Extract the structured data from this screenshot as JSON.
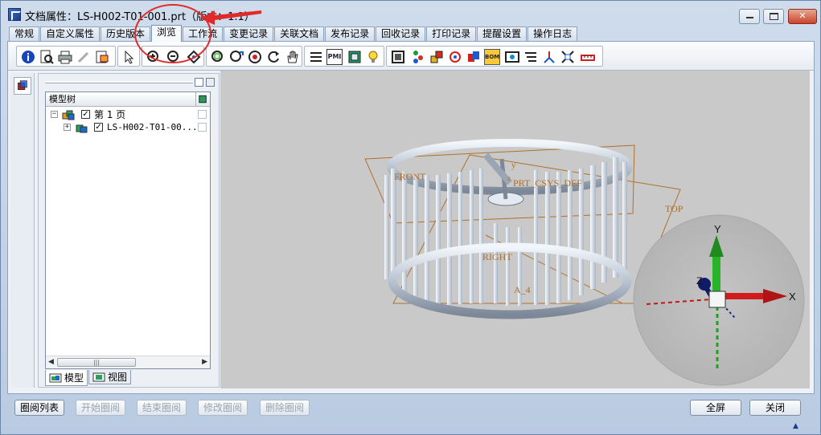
{
  "window": {
    "title": "文档属性：LS-H002-T01-001.prt（版本：1.1）",
    "minimize_glyph": "—",
    "restore_glyph": "",
    "close_glyph": "✕"
  },
  "tabs": [
    {
      "label": "常规",
      "active": false
    },
    {
      "label": "自定义属性",
      "active": false
    },
    {
      "label": "历史版本",
      "active": false
    },
    {
      "label": "浏览",
      "active": true
    },
    {
      "label": "工作流",
      "active": false
    },
    {
      "label": "变更记录",
      "active": false
    },
    {
      "label": "关联文档",
      "active": false
    },
    {
      "label": "发布记录",
      "active": false
    },
    {
      "label": "回收记录",
      "active": false
    },
    {
      "label": "打印记录",
      "active": false
    },
    {
      "label": "提醒设置",
      "active": false
    },
    {
      "label": "操作日志",
      "active": false
    }
  ],
  "toolbar": {
    "group1": [
      "info-icon",
      "print-preview-icon",
      "print-icon",
      "pen-icon",
      "export-icon"
    ],
    "group2": [
      "pointer-icon"
    ],
    "group3": [
      "zoom-in-icon",
      "zoom-out-icon",
      "zoom-fit-icon"
    ],
    "group4": [
      "zoom-window-icon",
      "pan-zoom-icon",
      "target-icon",
      "rotate-icon",
      "hand-icon"
    ],
    "group5": [
      "layers-icon",
      "pmi-icon",
      "part-icon",
      "bulb-icon"
    ],
    "group6": [
      "sheet-icon",
      "tree-icon",
      "assembly-icon",
      "explode-icon",
      "color-icon",
      "bom-icon",
      "measure-icon",
      "text-icon",
      "axis-icon",
      "fit-icon",
      "ruler-icon"
    ],
    "pmi_label": "PMI",
    "bom_label": "BOM"
  },
  "model_tree": {
    "header": "模型树",
    "rows": [
      {
        "label": "第 1 页",
        "checked": true,
        "expander": "−"
      },
      {
        "label": "LS-H002-T01-00...",
        "checked": true,
        "expander": "+"
      }
    ],
    "check_glyph": "✓",
    "scroll_left": "◀",
    "scroll_right": "▶",
    "thumb_grip": "|||"
  },
  "panel_tabs": [
    {
      "label": "模型",
      "active": true
    },
    {
      "label": "视图",
      "active": false
    }
  ],
  "viewport": {
    "background": "#c9c9c9",
    "datum_labels": {
      "front": "FRONT",
      "prt_csys": "PRT_CSYS_DEF",
      "top": "TOP",
      "right": "RIGHT",
      "axis": "A_4",
      "y_small": "y",
      "z_small": "z"
    },
    "triad": {
      "x": "X",
      "y": "Y",
      "z": "Z"
    },
    "colors": {
      "datum": "#b0702a",
      "x_axis": "#d11f1f",
      "y_axis": "#1fa01f",
      "z_axis": "#1a2a8a"
    }
  },
  "bottom": {
    "buttons": [
      {
        "label": "圈阅列表",
        "enabled": true
      },
      {
        "label": "开始圈阅",
        "enabled": false
      },
      {
        "label": "结束圈阅",
        "enabled": false
      },
      {
        "label": "修改圈阅",
        "enabled": false
      },
      {
        "label": "删除圈阅",
        "enabled": false
      }
    ],
    "fullscreen": "全屏",
    "close": "关闭"
  }
}
